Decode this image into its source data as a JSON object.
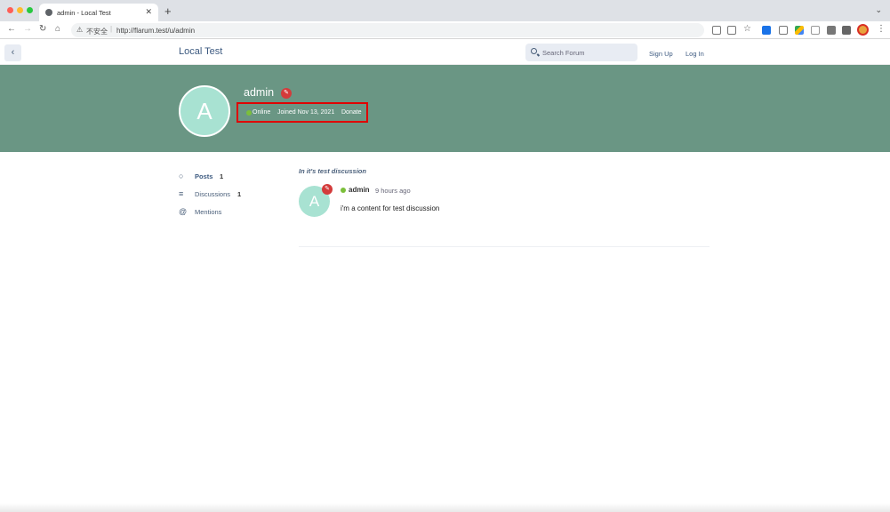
{
  "browser": {
    "tab_title": "admin - Local Test",
    "address_insecure": "不安全",
    "url": "http://flarum.test/u/admin"
  },
  "header": {
    "brand": "Local Test",
    "search_placeholder": "Search Forum",
    "sign_up": "Sign Up",
    "log_in": "Log In"
  },
  "profile": {
    "username": "admin",
    "avatar_letter": "A",
    "status": "Online",
    "joined": "Joined Nov 13, 2021",
    "donate": "Donate"
  },
  "sidebar": {
    "items": [
      {
        "label": "Posts",
        "count": "1",
        "icon": "comment-icon"
      },
      {
        "label": "Discussions",
        "count": "1",
        "icon": "list-icon"
      },
      {
        "label": "Mentions",
        "count": "",
        "icon": "at-icon"
      }
    ]
  },
  "post": {
    "discussion": "In it's test discussion",
    "author": "admin",
    "time": "9 hours ago",
    "body": "i'm a content for test discussion",
    "avatar_letter": "A"
  },
  "colors": {
    "hero": "#6a9684",
    "avatar": "#a8e2d2",
    "badge": "#d33b3b",
    "highlight": "#e00000"
  }
}
